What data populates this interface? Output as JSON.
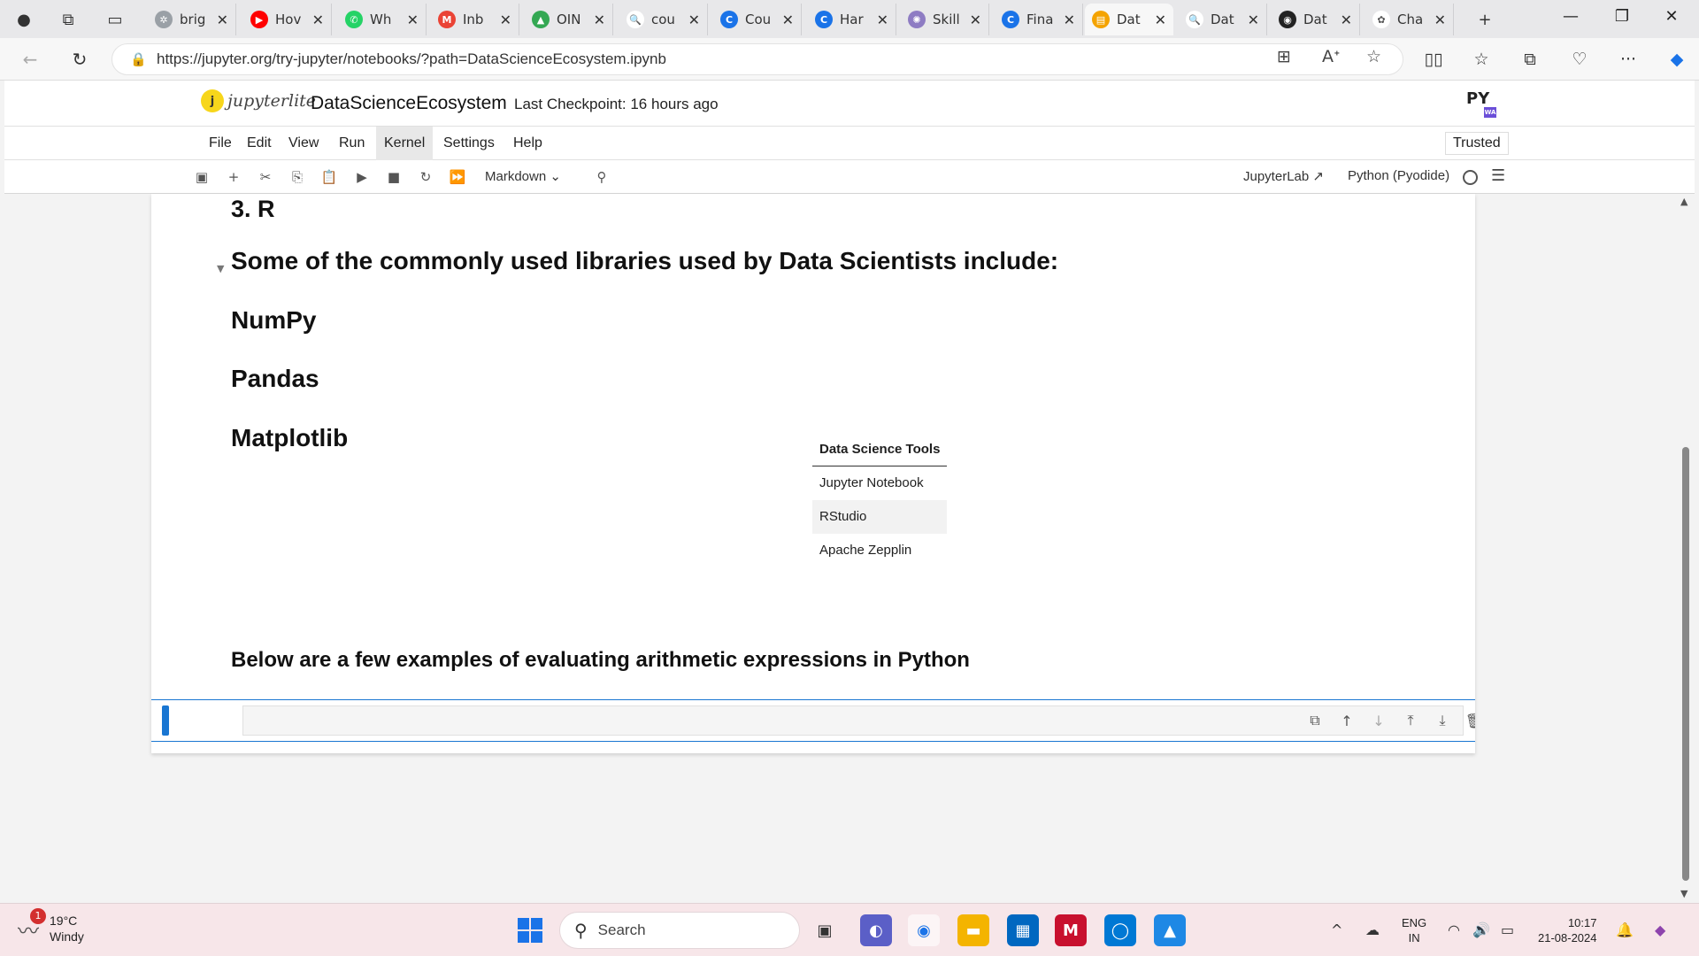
{
  "browser": {
    "tabs": [
      {
        "title": "brig",
        "color": "#9aa0a6",
        "glyph": "✲"
      },
      {
        "title": "Hov",
        "color": "#ff0000",
        "glyph": "▶"
      },
      {
        "title": "Wh",
        "color": "#25d366",
        "glyph": "✆"
      },
      {
        "title": "Inb",
        "color": "#ea4335",
        "glyph": "M"
      },
      {
        "title": "OIN",
        "color": "#34a853",
        "glyph": "▲"
      },
      {
        "title": "cou",
        "color": "#ffffff",
        "glyph": "🔍"
      },
      {
        "title": "Cou",
        "color": "#1a73e8",
        "glyph": "C"
      },
      {
        "title": "Har",
        "color": "#1a73e8",
        "glyph": "C"
      },
      {
        "title": "Skill",
        "color": "#8e7cc3",
        "glyph": "✺"
      },
      {
        "title": "Fina",
        "color": "#1a73e8",
        "glyph": "C"
      },
      {
        "title": "Dat",
        "color": "#f4a300",
        "glyph": "▤",
        "active": true
      },
      {
        "title": "Dat",
        "color": "#ffffff",
        "glyph": "🔍"
      },
      {
        "title": "Dat",
        "color": "#222222",
        "glyph": "◉"
      },
      {
        "title": "Cha",
        "color": "#ffffff",
        "glyph": "✿"
      }
    ],
    "close_glyph": "✕",
    "new_tab_glyph": "+",
    "url": "https://jupyter.org/try-jupyter/notebooks/?path=DataScienceEcosystem.ipynb"
  },
  "jupyter": {
    "logo_letter": "j",
    "logo_word": "jupyterlite",
    "notebook_title": "DataScienceEcosystem",
    "checkpoint": "Last Checkpoint: 16 hours ago",
    "py_logo": "PY",
    "py_badge": "WA",
    "menus": [
      "File",
      "Edit",
      "View",
      "Run",
      "Kernel",
      "Settings",
      "Help"
    ],
    "active_menu": "Kernel",
    "trusted": "Trusted",
    "cell_type": "Markdown",
    "jupyterlab_link": "JupyterLab",
    "kernel_name": "Python (Pyodide)"
  },
  "notebook": {
    "heading_r": "3. R",
    "libraries_heading": "Some of the commonly used libraries used by Data Scientists include:",
    "libraries": [
      "NumPy",
      "Pandas",
      "Matplotlib"
    ],
    "table_header": "Data Science Tools",
    "tools": [
      "Jupyter Notebook",
      "RStudio",
      "Apache Zepplin"
    ],
    "arithmetic_heading": "Below are a few examples of evaluating arithmetic expressions in Python"
  },
  "taskbar": {
    "temperature": "19°C",
    "weather": "Windy",
    "weather_badge": "1",
    "search_placeholder": "Search",
    "lang1": "ENG",
    "lang2": "IN",
    "time": "10:17",
    "date": "21-08-2024"
  }
}
